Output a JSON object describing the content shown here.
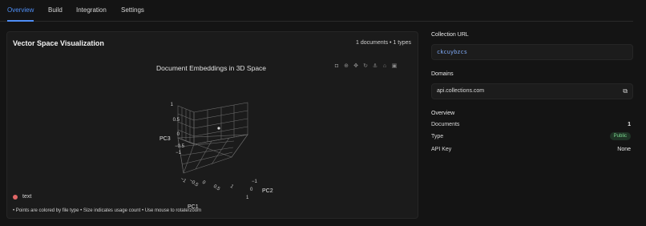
{
  "tabs": [
    "Overview",
    "Build",
    "Integration",
    "Settings"
  ],
  "panel": {
    "title": "Vector Space Visualization",
    "meta": "1 documents • 1 types",
    "plot_title": "Document Embeddings in 3D Space",
    "modebar_icons": [
      "camera-icon",
      "zoom-icon",
      "pan-icon",
      "orbit-icon",
      "turntable-icon",
      "home-icon",
      "reset-camera-icon"
    ],
    "axis_titles": {
      "x": "PC1",
      "y": "PC2",
      "z": "PC3"
    },
    "ticks": {
      "z": [
        "1",
        "0.5",
        "0",
        "−0.5",
        "−1"
      ],
      "x": [
        "−1",
        "−0.5",
        "0",
        "0.5",
        "1"
      ],
      "y": [
        "−1",
        "0",
        "1"
      ]
    },
    "legend_label": "text",
    "legend_color": "#e06666",
    "footnote": "• Points are colored by file type • Size indicates usage count • Use mouse to rotate/zoom"
  },
  "chart_data": {
    "type": "scatter",
    "title": "Document Embeddings in 3D Space",
    "axes": {
      "x": "PC1",
      "y": "PC2",
      "z": "PC3"
    },
    "ranges": {
      "x": [
        -1,
        1
      ],
      "y": [
        -1,
        1
      ],
      "z": [
        -1,
        1
      ]
    },
    "series": [
      {
        "name": "text",
        "color": "#e06666",
        "points": [
          {
            "x": 0,
            "y": 0,
            "z": 0
          }
        ]
      }
    ]
  },
  "right": {
    "collection_url_label": "Collection URL",
    "collection_url": "ckcuybzcs",
    "domains_label": "Domains",
    "domain": "api.collections.com",
    "overview_label": "Overview",
    "rows": [
      {
        "label": "Documents",
        "value": "1"
      },
      {
        "label": "Type",
        "value": "Public"
      },
      {
        "label": "API Key",
        "value": "None"
      }
    ]
  }
}
